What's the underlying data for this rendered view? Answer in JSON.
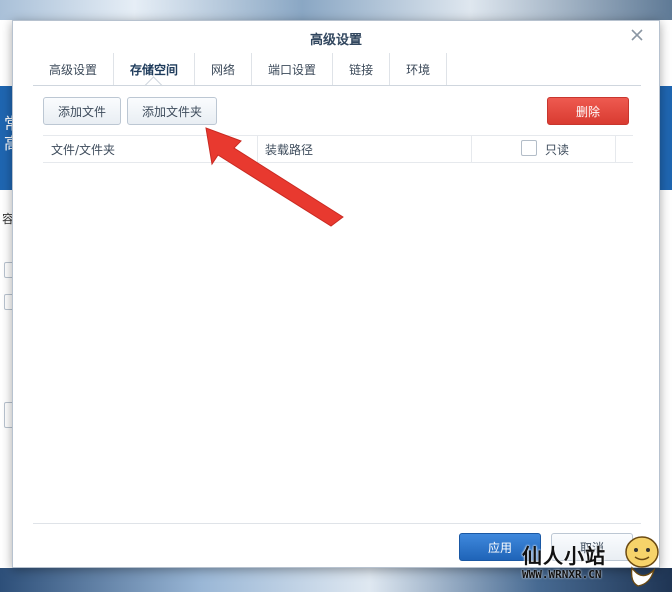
{
  "dialog": {
    "title": "高级设置",
    "tabs": [
      {
        "label": "高级设置"
      },
      {
        "label": "存储空间",
        "active": true
      },
      {
        "label": "网络"
      },
      {
        "label": "端口设置"
      },
      {
        "label": "链接"
      },
      {
        "label": "环境"
      }
    ],
    "toolbar": {
      "add_file": "添加文件",
      "add_folder": "添加文件夹",
      "delete": "删除"
    },
    "table": {
      "columns": {
        "file_folder": "文件/文件夹",
        "mount_path": "装载路径",
        "readonly": "只读"
      },
      "rows": []
    },
    "footer": {
      "apply": "应用",
      "cancel": "取消"
    }
  },
  "background": {
    "band_text": "常\n高",
    "side_text": "容"
  },
  "watermark": {
    "name": "仙人小站",
    "url": "WWW.WRNXR.CN"
  },
  "colors": {
    "accent": "#1f64b8",
    "danger": "#d93b31",
    "arrow": "#e8392f"
  },
  "icons": {
    "close": "close-icon",
    "arrow": "red-arrow-annotation"
  }
}
